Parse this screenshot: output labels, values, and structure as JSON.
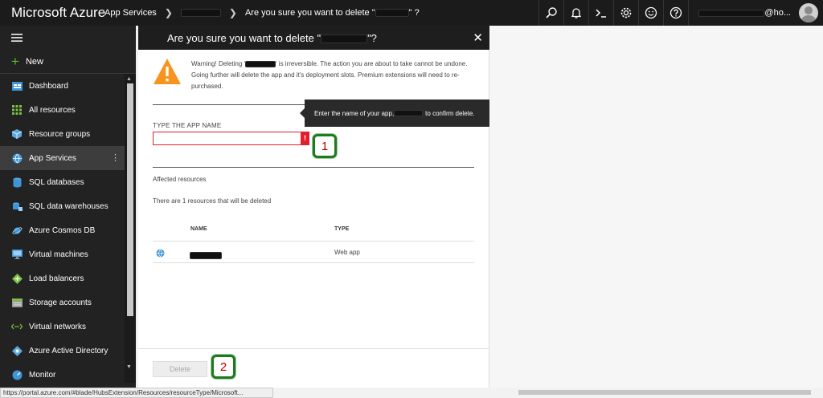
{
  "topbar": {
    "brand": "Microsoft Azure",
    "crumb1": "App Services",
    "crumb3": "Are you sure you want to delete \"",
    "crumb3_end": "\" ?",
    "account": "@ho..."
  },
  "sidebar": {
    "new_label": "New",
    "items": [
      {
        "label": "Dashboard",
        "icon": "dashboard-icon"
      },
      {
        "label": "All resources",
        "icon": "grid-icon"
      },
      {
        "label": "Resource groups",
        "icon": "cube-icon"
      },
      {
        "label": "App Services",
        "icon": "globe-icon"
      },
      {
        "label": "SQL databases",
        "icon": "database-icon"
      },
      {
        "label": "SQL data warehouses",
        "icon": "warehouse-icon"
      },
      {
        "label": "Azure Cosmos DB",
        "icon": "planet-icon"
      },
      {
        "label": "Virtual machines",
        "icon": "monitor-icon"
      },
      {
        "label": "Load balancers",
        "icon": "balancer-icon"
      },
      {
        "label": "Storage accounts",
        "icon": "storage-icon"
      },
      {
        "label": "Virtual networks",
        "icon": "network-icon"
      },
      {
        "label": "Azure Active Directory",
        "icon": "diamond-icon"
      },
      {
        "label": "Monitor",
        "icon": "monitor-gauge-icon"
      }
    ],
    "active_index": 3
  },
  "blade": {
    "title_start": "Are you sure you want to delete \"",
    "title_end": "\"?",
    "warning_part1": "Warning! Deleting '",
    "warning_part2": "' is irreversible. The action you are about to take cannot be undone. Going further will delete the app and it's deployment slots. Premium extensions will need to re-purchased.",
    "field_label": "TYPE THE APP NAME",
    "input_value": "",
    "error_mark": "!",
    "affected_label": "Affected resources",
    "count_text": "There are 1 resources that will be deleted",
    "col_name": "NAME",
    "col_type": "TYPE",
    "resource_type": "Web app",
    "delete_label": "Delete"
  },
  "tooltip": {
    "part1": "Enter the name of your app, ",
    "part2": " to confirm delete."
  },
  "callouts": [
    "1",
    "2"
  ],
  "status_url": "https://portal.azure.com/#blade/HubsExtension/Resources/resourceType/Microsoft...",
  "colors": {
    "topbar": "#1b1b1b",
    "sidebar": "#222222",
    "brand_blue": "#0072c6",
    "error_red": "#e01f2d",
    "warning_orange": "#f7941d",
    "callout_green": "#1e7a1e"
  }
}
